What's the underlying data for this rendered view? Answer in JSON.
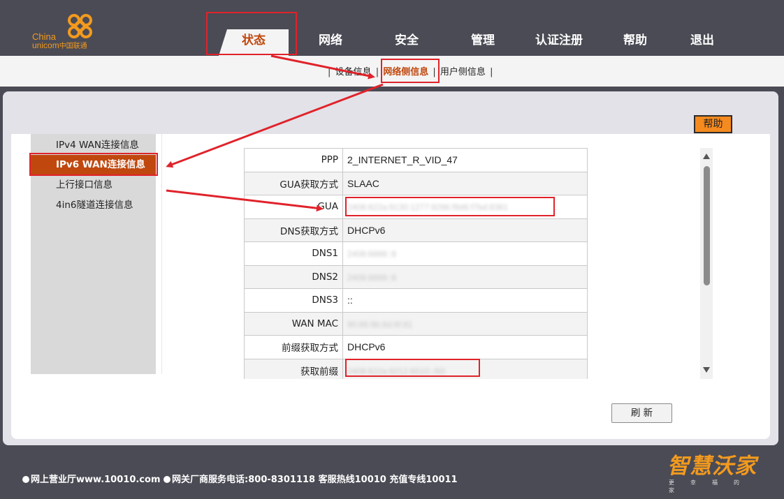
{
  "logo": {
    "text_en": "China",
    "text_en2": "unicom",
    "text_cn": "中国联通"
  },
  "nav": {
    "tabs": [
      {
        "label": "状态"
      },
      {
        "label": "网络"
      },
      {
        "label": "安全"
      },
      {
        "label": "管理"
      },
      {
        "label": "认证注册"
      },
      {
        "label": "帮助"
      },
      {
        "label": "退出"
      }
    ],
    "active_index": 0
  },
  "subnav": {
    "items": [
      {
        "label": "设备信息"
      },
      {
        "label": "网络侧信息"
      },
      {
        "label": "用户侧信息"
      }
    ],
    "separator": "|",
    "active_index": 1
  },
  "help_button": "帮助",
  "left_menu": {
    "items": [
      {
        "label": "IPv4 WAN连接信息"
      },
      {
        "label": "IPv6 WAN连接信息"
      },
      {
        "label": "上行接口信息"
      },
      {
        "label": "4in6隧道连接信息"
      }
    ],
    "active_index": 1
  },
  "info_table": {
    "rows": [
      {
        "key": "PPP",
        "value": "2_INTERNET_R_VID_47"
      },
      {
        "key": "GUA获取方式",
        "value": "SLAAC"
      },
      {
        "key": "GUA",
        "value": "2408:822a:9130:1277:9286:f9d6:f7bd:8361"
      },
      {
        "key": "DNS获取方式",
        "value": "DHCPv6"
      },
      {
        "key": "DNS1",
        "value": "2408:8888::8"
      },
      {
        "key": "DNS2",
        "value": "2408:8899::8"
      },
      {
        "key": "DNS3",
        "value": "::"
      },
      {
        "key": "WAN MAC",
        "value": "90:86:9b:8d:6f:81"
      },
      {
        "key": "前缀获取方式",
        "value": "DHCPv6"
      },
      {
        "key": "获取前缀",
        "value": "2408:822a:9212:6510::/60"
      }
    ]
  },
  "refresh_button": "刷 新",
  "footer": {
    "item1": "网上营业厅www.10010.com",
    "item2": "网关厂商服务电话:800-8301118 客服热线10010 充值专线10011"
  },
  "brand": {
    "main": "智慧沃家",
    "sub": "更幸福的家"
  },
  "colors": {
    "accent": "#c0480e",
    "header_bg": "#4b4b55",
    "help_orange": "#f58a1f",
    "annotation_red": "#e0222a"
  }
}
